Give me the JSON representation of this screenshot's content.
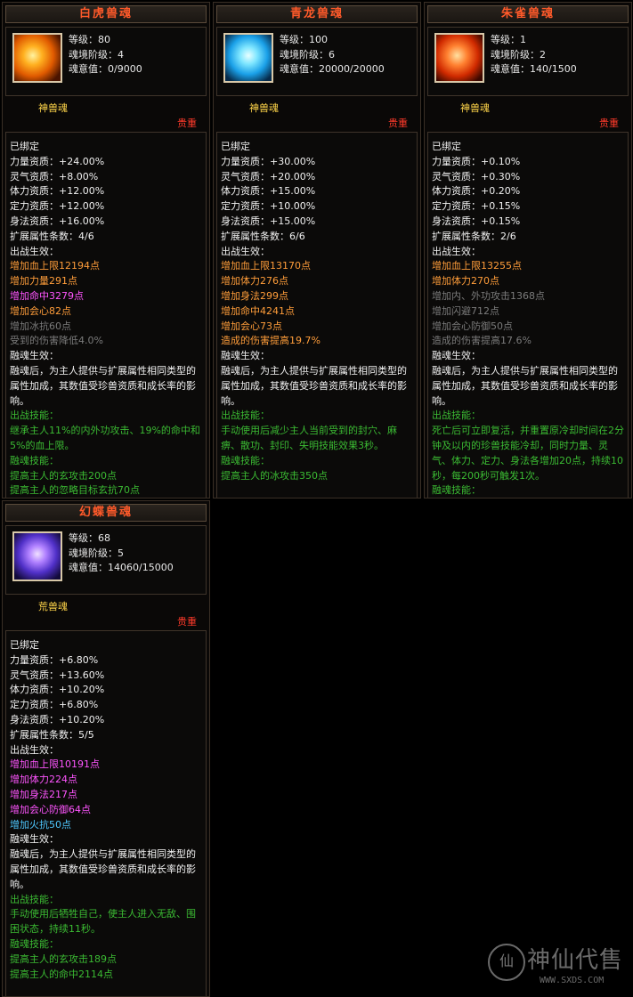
{
  "cards": [
    {
      "title": "白虎兽魂",
      "level": "等级：80",
      "stage": "魂境阶级：4",
      "spirit": "魂意值：0/9000",
      "type": "神兽魂",
      "rarity": "贵重",
      "lines": [
        {
          "t": "已绑定",
          "c": "white"
        },
        {
          "t": "力量资质：+24.00%",
          "c": "white"
        },
        {
          "t": "灵气资质：+8.00%",
          "c": "white"
        },
        {
          "t": "体力资质：+12.00%",
          "c": "white"
        },
        {
          "t": "定力资质：+12.00%",
          "c": "white"
        },
        {
          "t": "身法资质：+16.00%",
          "c": "white"
        },
        {
          "t": "扩展属性条数：4/6",
          "c": "white"
        },
        {
          "t": "出战生效：",
          "c": "white"
        },
        {
          "t": "增加血上限12194点",
          "c": "orange"
        },
        {
          "t": "增加力量291点",
          "c": "orange"
        },
        {
          "t": "增加命中3279点",
          "c": "purple"
        },
        {
          "t": "增加会心82点",
          "c": "orange"
        },
        {
          "t": "增加冰抗60点",
          "c": "gray"
        },
        {
          "t": "受到的伤害降低4.0%",
          "c": "gray"
        },
        {
          "t": "融魂生效：",
          "c": "white"
        },
        {
          "t": "融魂后，为主人提供与扩展属性相同类型的属性加成，其数值受珍兽资质和成长率的影响。",
          "c": "white"
        },
        {
          "t": "出战技能：",
          "c": "green"
        },
        {
          "t": "继承主人11%的内外功攻击、19%的命中和5%的血上限。",
          "c": "green"
        },
        {
          "t": "融魂技能：",
          "c": "green"
        },
        {
          "t": "提高主人的玄攻击200点",
          "c": "green"
        },
        {
          "t": "提高主人的忽略目标玄抗70点",
          "c": "green"
        }
      ]
    },
    {
      "title": "青龙兽魂",
      "level": "等级：100",
      "stage": "魂境阶级：6",
      "spirit": "魂意值：20000/20000",
      "type": "神兽魂",
      "rarity": "贵重",
      "lines": [
        {
          "t": "已绑定",
          "c": "white"
        },
        {
          "t": "力量资质：+30.00%",
          "c": "white"
        },
        {
          "t": "灵气资质：+20.00%",
          "c": "white"
        },
        {
          "t": "体力资质：+15.00%",
          "c": "white"
        },
        {
          "t": "定力资质：+10.00%",
          "c": "white"
        },
        {
          "t": "身法资质：+15.00%",
          "c": "white"
        },
        {
          "t": "扩展属性条数：6/6",
          "c": "white"
        },
        {
          "t": "出战生效：",
          "c": "white"
        },
        {
          "t": "增加血上限13170点",
          "c": "orange"
        },
        {
          "t": "增加体力276点",
          "c": "orange"
        },
        {
          "t": "增加身法299点",
          "c": "orange"
        },
        {
          "t": "增加命中4241点",
          "c": "orange"
        },
        {
          "t": "增加会心73点",
          "c": "orange"
        },
        {
          "t": "造成的伤害提高19.7%",
          "c": "orange"
        },
        {
          "t": "融魂生效：",
          "c": "white"
        },
        {
          "t": "融魂后，为主人提供与扩展属性相同类型的属性加成，其数值受珍兽资质和成长率的影响。",
          "c": "white"
        },
        {
          "t": "出战技能：",
          "c": "green"
        },
        {
          "t": "手动使用后减少主人当前受到的封穴、麻痹、散功、封印、失明技能效果3秒。",
          "c": "green"
        },
        {
          "t": "融魂技能：",
          "c": "green"
        },
        {
          "t": "提高主人的冰攻击350点",
          "c": "green"
        }
      ]
    },
    {
      "title": "朱雀兽魂",
      "level": "等级：1",
      "stage": "魂境阶级：2",
      "spirit": "魂意值：140/1500",
      "type": "神兽魂",
      "rarity": "贵重",
      "lines": [
        {
          "t": "已绑定",
          "c": "white"
        },
        {
          "t": "力量资质：+0.10%",
          "c": "white"
        },
        {
          "t": "灵气资质：+0.30%",
          "c": "white"
        },
        {
          "t": "体力资质：+0.20%",
          "c": "white"
        },
        {
          "t": "定力资质：+0.15%",
          "c": "white"
        },
        {
          "t": "身法资质：+0.15%",
          "c": "white"
        },
        {
          "t": "扩展属性条数：2/6",
          "c": "white"
        },
        {
          "t": "出战生效：",
          "c": "white"
        },
        {
          "t": "增加血上限13255点",
          "c": "orange"
        },
        {
          "t": "增加体力270点",
          "c": "orange"
        },
        {
          "t": "增加内、外功攻击1368点",
          "c": "gray"
        },
        {
          "t": "增加闪避712点",
          "c": "gray"
        },
        {
          "t": "增加会心防御50点",
          "c": "gray"
        },
        {
          "t": "造成的伤害提高17.6%",
          "c": "gray"
        },
        {
          "t": "融魂生效：",
          "c": "white"
        },
        {
          "t": "融魂后，为主人提供与扩展属性相同类型的属性加成，其数值受珍兽资质和成长率的影响。",
          "c": "white"
        },
        {
          "t": "出战技能：",
          "c": "green"
        },
        {
          "t": "死亡后可立即复活，并重置原冷却时间在2分钟及以内的珍兽技能冷却，同时力量、灵气、体力、定力、身法各增加20点，持续10秒，每200秒可触发1次。",
          "c": "green"
        },
        {
          "t": "融魂技能：",
          "c": "green"
        }
      ]
    },
    {
      "title": "幻蝶兽魂",
      "level": "等级：68",
      "stage": "魂境阶级：5",
      "spirit": "魂意值：14060/15000",
      "type": "荒兽魂",
      "rarity": "贵重",
      "lines": [
        {
          "t": "已绑定",
          "c": "white"
        },
        {
          "t": "力量资质：+6.80%",
          "c": "white"
        },
        {
          "t": "灵气资质：+13.60%",
          "c": "white"
        },
        {
          "t": "体力资质：+10.20%",
          "c": "white"
        },
        {
          "t": "定力资质：+6.80%",
          "c": "white"
        },
        {
          "t": "身法资质：+10.20%",
          "c": "white"
        },
        {
          "t": "扩展属性条数：5/5",
          "c": "white"
        },
        {
          "t": "出战生效：",
          "c": "white"
        },
        {
          "t": "增加血上限10191点",
          "c": "purple"
        },
        {
          "t": "增加体力224点",
          "c": "purple"
        },
        {
          "t": "增加身法217点",
          "c": "purple"
        },
        {
          "t": "增加会心防御64点",
          "c": "purple"
        },
        {
          "t": "增加火抗50点",
          "c": "blue"
        },
        {
          "t": "融魂生效：",
          "c": "white"
        },
        {
          "t": "融魂后，为主人提供与扩展属性相同类型的属性加成，其数值受珍兽资质和成长率的影响。",
          "c": "white"
        },
        {
          "t": "出战技能：",
          "c": "green"
        },
        {
          "t": "手动使用后牺牲自己，使主人进入无敌、围困状态，持续11秒。",
          "c": "green"
        },
        {
          "t": "融魂技能：",
          "c": "green"
        },
        {
          "t": "提高主人的玄攻击189点",
          "c": "green"
        },
        {
          "t": "提高主人的命中2114点",
          "c": "green"
        }
      ]
    }
  ],
  "watermark": {
    "text": "神仙代售",
    "url": "WWW.SXDS.COM"
  }
}
